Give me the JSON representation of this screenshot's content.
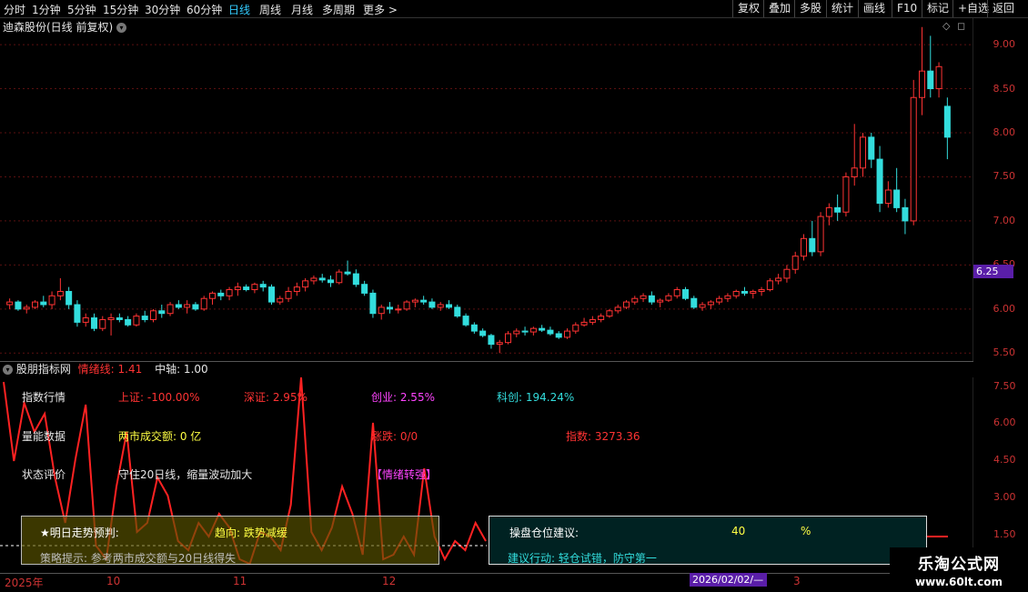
{
  "toolbar": {
    "periods": [
      "分时",
      "1分钟",
      "5分钟",
      "15分钟",
      "30分钟",
      "60分钟",
      "日线",
      "周线",
      "月线",
      "多周期",
      "更多 >"
    ],
    "active_period": "日线",
    "right_buttons": [
      "复权",
      "叠加",
      "多股",
      "统计",
      "画线",
      "F10",
      "标记",
      "+自选",
      "返回"
    ]
  },
  "stock_title": "迪森股份(日线 前复权)",
  "price_axis": [
    "9.00",
    "8.50",
    "8.00",
    "7.50",
    "7.00",
    "6.50",
    "6.00",
    "5.50"
  ],
  "current_price": "6.25",
  "indicator": {
    "name": "股朋指标网",
    "line_label": "情绪线: 1.41",
    "axis_label": "中轴: 1.00",
    "axis_ticks": [
      "7.50",
      "6.00",
      "4.50",
      "3.00",
      "1.50"
    ],
    "rows": {
      "index_label": "指数行情",
      "shanghai": "上证: -100.00%",
      "shenzhen": "深证: 2.95%",
      "chinext": "创业: 2.55%",
      "star": "科创: 194.24%",
      "volume_label": "量能数据",
      "turnover": "两市成交额: 0 亿",
      "updown": "涨跌: 0/0",
      "index_value": "指数: 3273.36",
      "status_label": "状态评价",
      "status_text": "守住20日线，缩量波动加大",
      "mood": "【情绪转强】",
      "forecast_label": "★明日走势预判:",
      "trend": "趋向: 跌势减缓",
      "tip": "策略提示: 参考两市成交额与20日线得失",
      "position_label": "操盘仓位建议:",
      "position_value": "40",
      "position_unit": "%",
      "action": "建议行动: 轻仓试错，防守第一"
    }
  },
  "bottom_axis": [
    "2025年",
    "10",
    "11",
    "12",
    "3"
  ],
  "date_badge": "2026/02/02/—",
  "watermark": {
    "title": "乐淘公式网",
    "url": "www.60lt.com"
  },
  "chart_data": {
    "type": "candlestick",
    "ylim": [
      5.4,
      9.3
    ],
    "candles": [
      [
        6.05,
        6.12,
        6.0,
        6.08
      ],
      [
        6.08,
        6.1,
        5.98,
        6.0
      ],
      [
        6.0,
        6.05,
        5.95,
        6.02
      ],
      [
        6.02,
        6.1,
        6.0,
        6.08
      ],
      [
        6.08,
        6.15,
        6.02,
        6.05
      ],
      [
        6.05,
        6.2,
        6.0,
        6.15
      ],
      [
        6.15,
        6.35,
        6.1,
        6.2
      ],
      [
        6.2,
        6.25,
        6.0,
        6.05
      ],
      [
        6.05,
        6.1,
        5.8,
        5.85
      ],
      [
        5.85,
        5.95,
        5.8,
        5.9
      ],
      [
        5.9,
        5.95,
        5.75,
        5.78
      ],
      [
        5.78,
        5.92,
        5.75,
        5.88
      ],
      [
        5.88,
        5.95,
        5.7,
        5.9
      ],
      [
        5.9,
        5.95,
        5.85,
        5.88
      ],
      [
        5.88,
        5.92,
        5.8,
        5.82
      ],
      [
        5.82,
        5.95,
        5.8,
        5.92
      ],
      [
        5.92,
        5.98,
        5.85,
        5.88
      ],
      [
        5.88,
        6.0,
        5.85,
        5.98
      ],
      [
        5.98,
        6.05,
        5.9,
        5.95
      ],
      [
        5.95,
        6.08,
        5.92,
        6.05
      ],
      [
        6.05,
        6.1,
        6.0,
        6.02
      ],
      [
        6.02,
        6.1,
        5.95,
        6.05
      ],
      [
        6.05,
        6.08,
        5.98,
        6.0
      ],
      [
        6.0,
        6.15,
        5.98,
        6.12
      ],
      [
        6.12,
        6.2,
        6.05,
        6.18
      ],
      [
        6.18,
        6.22,
        6.1,
        6.15
      ],
      [
        6.15,
        6.25,
        6.1,
        6.22
      ],
      [
        6.22,
        6.3,
        6.15,
        6.25
      ],
      [
        6.25,
        6.28,
        6.2,
        6.22
      ],
      [
        6.22,
        6.3,
        6.18,
        6.28
      ],
      [
        6.28,
        6.32,
        6.2,
        6.25
      ],
      [
        6.25,
        6.28,
        6.05,
        6.08
      ],
      [
        6.08,
        6.15,
        6.05,
        6.12
      ],
      [
        6.12,
        6.25,
        6.08,
        6.2
      ],
      [
        6.2,
        6.3,
        6.15,
        6.25
      ],
      [
        6.25,
        6.35,
        6.2,
        6.32
      ],
      [
        6.32,
        6.38,
        6.28,
        6.35
      ],
      [
        6.35,
        6.4,
        6.3,
        6.33
      ],
      [
        6.33,
        6.38,
        6.25,
        6.3
      ],
      [
        6.3,
        6.45,
        6.28,
        6.42
      ],
      [
        6.42,
        6.55,
        6.38,
        6.4
      ],
      [
        6.4,
        6.45,
        6.25,
        6.28
      ],
      [
        6.28,
        6.32,
        6.15,
        6.18
      ],
      [
        6.18,
        6.22,
        5.9,
        5.95
      ],
      [
        5.95,
        6.05,
        5.88,
        6.02
      ],
      [
        6.02,
        6.08,
        5.95,
        6.0
      ],
      [
        6.0,
        6.05,
        5.95,
        6.0
      ],
      [
        6.0,
        6.1,
        5.98,
        6.08
      ],
      [
        6.08,
        6.12,
        6.02,
        6.1
      ],
      [
        6.1,
        6.15,
        6.05,
        6.08
      ],
      [
        6.08,
        6.12,
        6.0,
        6.02
      ],
      [
        6.02,
        6.08,
        5.98,
        6.05
      ],
      [
        6.05,
        6.1,
        6.0,
        6.02
      ],
      [
        6.02,
        6.05,
        5.9,
        5.92
      ],
      [
        5.92,
        5.95,
        5.8,
        5.82
      ],
      [
        5.82,
        5.85,
        5.72,
        5.75
      ],
      [
        5.75,
        5.78,
        5.68,
        5.7
      ],
      [
        5.7,
        5.72,
        5.55,
        5.6
      ],
      [
        5.6,
        5.65,
        5.5,
        5.62
      ],
      [
        5.62,
        5.75,
        5.6,
        5.72
      ],
      [
        5.72,
        5.78,
        5.68,
        5.75
      ],
      [
        5.75,
        5.8,
        5.7,
        5.74
      ],
      [
        5.74,
        5.8,
        5.7,
        5.78
      ],
      [
        5.78,
        5.82,
        5.74,
        5.76
      ],
      [
        5.76,
        5.8,
        5.7,
        5.72
      ],
      [
        5.72,
        5.75,
        5.66,
        5.68
      ],
      [
        5.68,
        5.78,
        5.66,
        5.75
      ],
      [
        5.75,
        5.85,
        5.72,
        5.82
      ],
      [
        5.82,
        5.9,
        5.8,
        5.85
      ],
      [
        5.85,
        5.92,
        5.82,
        5.88
      ],
      [
        5.88,
        5.95,
        5.85,
        5.92
      ],
      [
        5.92,
        6.0,
        5.9,
        5.98
      ],
      [
        5.98,
        6.05,
        5.95,
        6.02
      ],
      [
        6.02,
        6.1,
        6.0,
        6.08
      ],
      [
        6.08,
        6.15,
        6.05,
        6.12
      ],
      [
        6.12,
        6.18,
        6.08,
        6.15
      ],
      [
        6.15,
        6.2,
        6.05,
        6.08
      ],
      [
        6.08,
        6.12,
        6.02,
        6.1
      ],
      [
        6.1,
        6.18,
        6.08,
        6.15
      ],
      [
        6.15,
        6.25,
        6.12,
        6.22
      ],
      [
        6.22,
        6.25,
        6.1,
        6.12
      ],
      [
        6.12,
        6.15,
        6.0,
        6.02
      ],
      [
        6.02,
        6.08,
        5.98,
        6.05
      ],
      [
        6.05,
        6.1,
        6.0,
        6.08
      ],
      [
        6.08,
        6.15,
        6.05,
        6.12
      ],
      [
        6.12,
        6.18,
        6.08,
        6.15
      ],
      [
        6.15,
        6.22,
        6.12,
        6.2
      ],
      [
        6.2,
        6.25,
        6.15,
        6.18
      ],
      [
        6.18,
        6.22,
        6.12,
        6.2
      ],
      [
        6.2,
        6.25,
        6.15,
        6.22
      ],
      [
        6.22,
        6.35,
        6.2,
        6.32
      ],
      [
        6.32,
        6.4,
        6.28,
        6.35
      ],
      [
        6.35,
        6.5,
        6.3,
        6.45
      ],
      [
        6.45,
        6.65,
        6.4,
        6.6
      ],
      [
        6.6,
        6.85,
        6.55,
        6.8
      ],
      [
        6.8,
        7.0,
        6.6,
        6.65
      ],
      [
        6.65,
        7.1,
        6.6,
        7.05
      ],
      [
        7.05,
        7.2,
        6.95,
        7.15
      ],
      [
        7.15,
        7.3,
        7.0,
        7.1
      ],
      [
        7.1,
        7.55,
        7.05,
        7.5
      ],
      [
        7.5,
        8.1,
        7.4,
        7.6
      ],
      [
        7.6,
        8.0,
        7.5,
        7.95
      ],
      [
        7.95,
        8.0,
        7.6,
        7.7
      ],
      [
        7.7,
        7.85,
        7.1,
        7.2
      ],
      [
        7.2,
        7.45,
        7.15,
        7.35
      ],
      [
        7.35,
        7.6,
        7.1,
        7.15
      ],
      [
        7.15,
        7.25,
        6.85,
        7.0
      ],
      [
        7.0,
        8.6,
        6.95,
        8.4
      ],
      [
        8.4,
        9.2,
        8.2,
        8.7
      ],
      [
        8.7,
        9.1,
        8.4,
        8.5
      ],
      [
        8.5,
        8.8,
        8.4,
        8.75
      ],
      [
        8.3,
        8.4,
        7.7,
        7.95
      ]
    ]
  }
}
